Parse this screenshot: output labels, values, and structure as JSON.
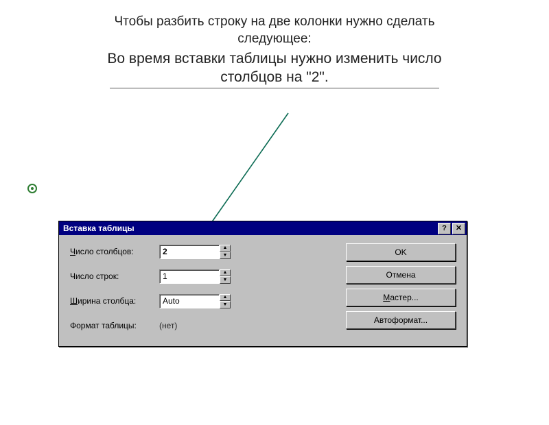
{
  "slide": {
    "title_line1": "Чтобы разбить строку на две колонки нужно сделать",
    "title_line2": "следующее:",
    "subtitle_line1": "Во время вставки таблицы нужно изменить число",
    "subtitle_line2": "столбцов на \"2\"."
  },
  "dialog": {
    "title": "Вставка таблицы",
    "help_glyph": "?",
    "close_glyph": "✕",
    "labels": {
      "cols_pre": "Ч",
      "cols_post": "исло столбцов:",
      "rows": "Число строк:",
      "width_pre": "Ш",
      "width_post": "ирина столбца:",
      "format": "Формат таблицы:"
    },
    "values": {
      "cols": "2",
      "rows": "1",
      "width": "Auto",
      "format": "(нет)"
    },
    "buttons": {
      "ok": "OK",
      "cancel": "Отмена",
      "wizard_pre": "М",
      "wizard_post": "астер...",
      "autoformat": "Автоформат..."
    },
    "spin": {
      "up": "▲",
      "down": "▼"
    }
  }
}
